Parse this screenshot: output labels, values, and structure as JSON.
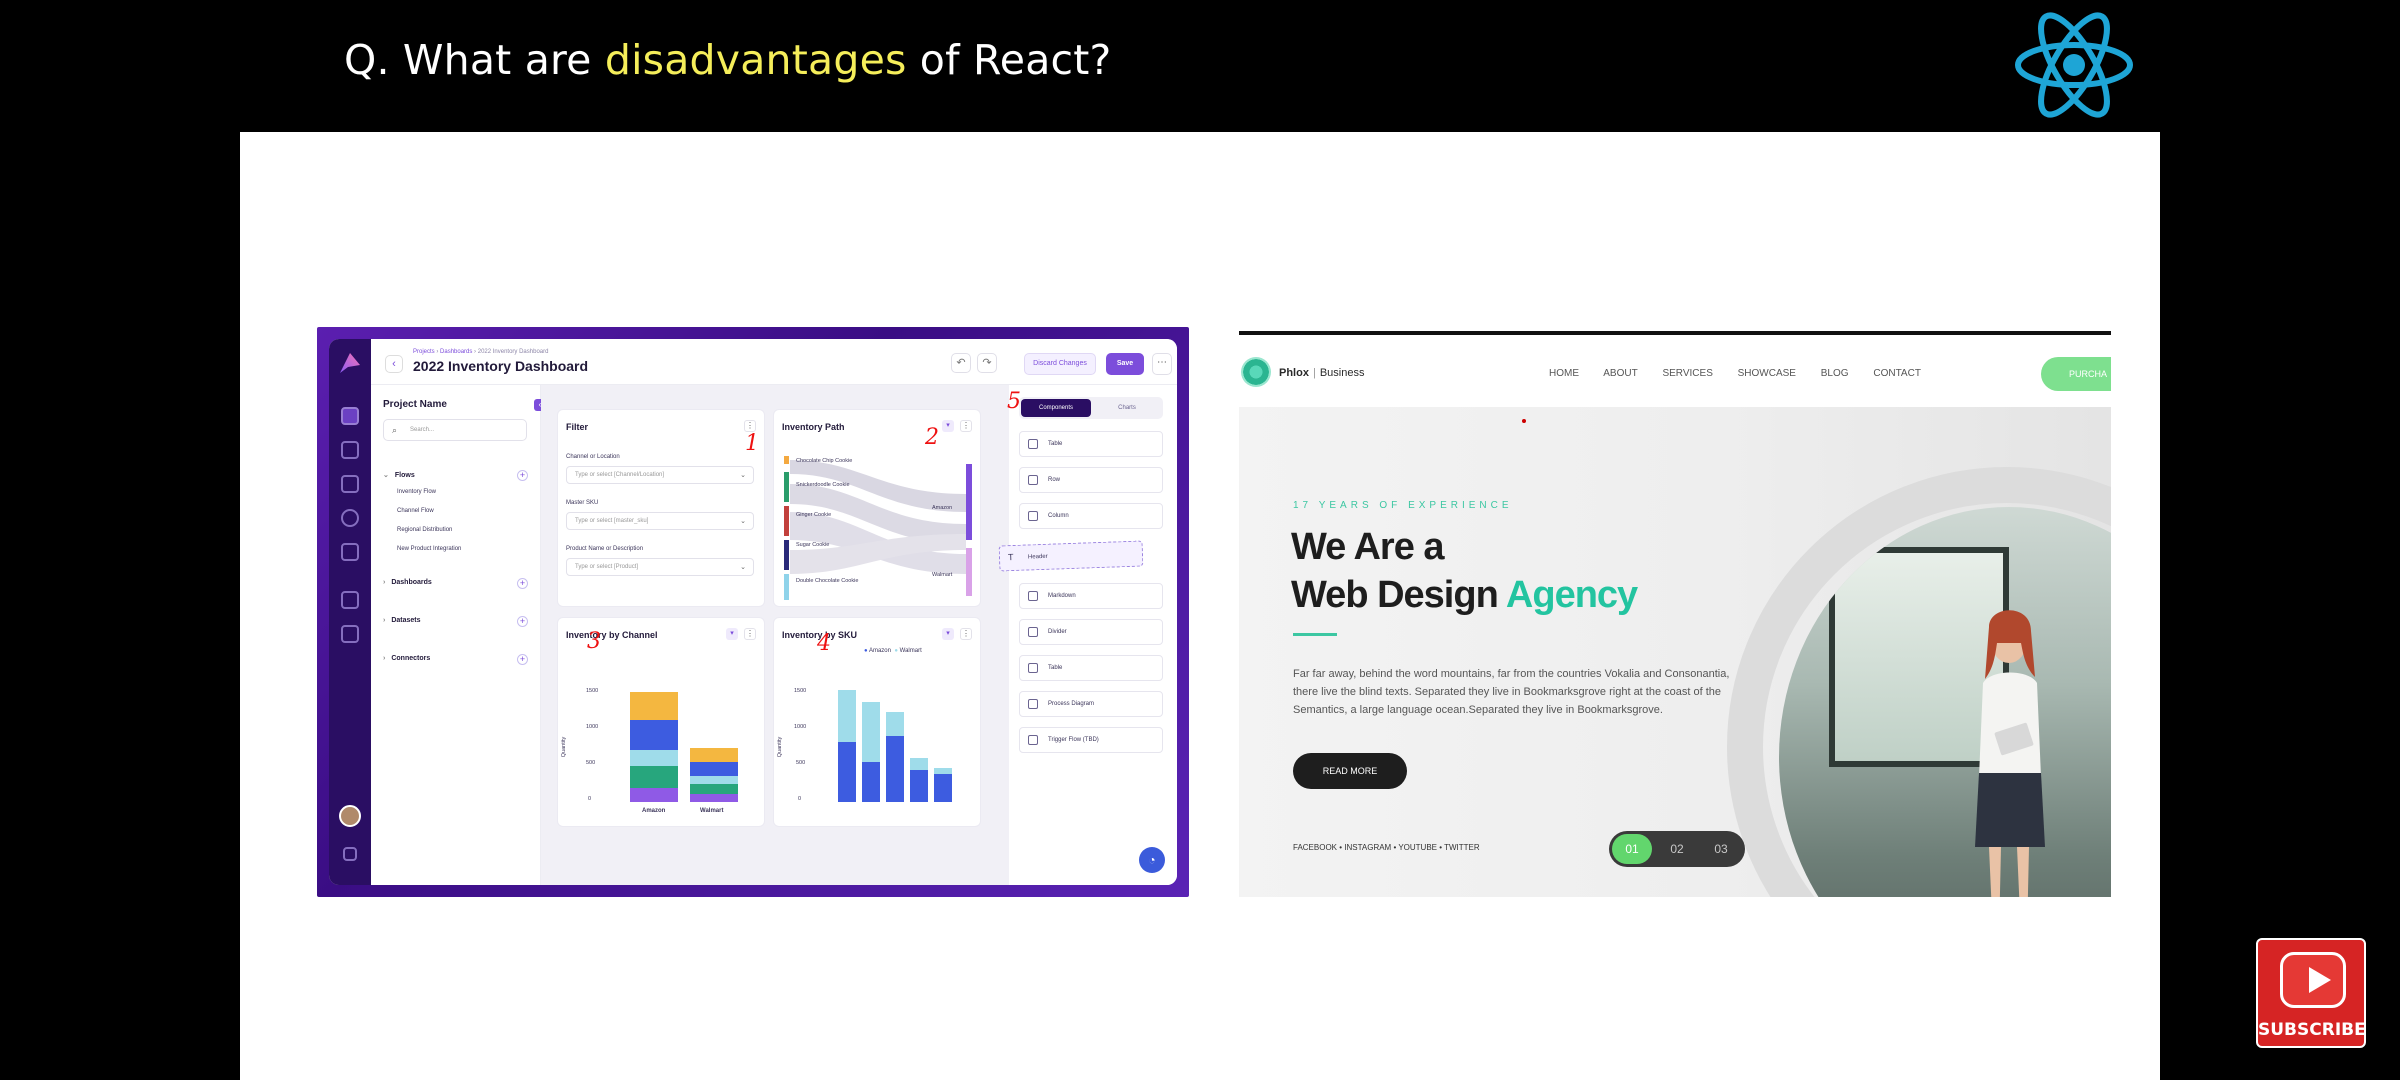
{
  "slide": {
    "title_prefix": "Q. What are ",
    "title_highlight": "disadvantages",
    "title_suffix": " of React?",
    "highlight_color": "#f5ee5a",
    "react_logo_color": "#1ea5d6"
  },
  "dashboard": {
    "breadcrumb": [
      "Projects",
      "Dashboards",
      "2022 Inventory Dashboard"
    ],
    "title": "2022 Inventory Dashboard",
    "discard_label": "Discard Changes",
    "save_label": "Save",
    "more_label": "⋯",
    "side": {
      "title": "Project Name",
      "search_placeholder": "Search...",
      "sections": [
        {
          "label": "Flows",
          "items": [
            "Inventory Flow",
            "Channel Flow",
            "Regional Distribution",
            "New Product Integration"
          ]
        },
        {
          "label": "Dashboards"
        },
        {
          "label": "Datasets"
        },
        {
          "label": "Connectors"
        }
      ]
    },
    "filter": {
      "title": "Filter",
      "fields": [
        {
          "label": "Channel or Location",
          "placeholder": "Type or select [Channel/Location]"
        },
        {
          "label": "Master SKU",
          "placeholder": "Type or select [master_sku]"
        },
        {
          "label": "Product Name or Description",
          "placeholder": "Type or select [Product]"
        }
      ]
    },
    "inventory_path": {
      "title": "Inventory Path",
      "items": [
        "Chocolate Chip Cookie",
        "Snickerdoodle Cookie",
        "Ginger Cookie",
        "Sugar Cookie",
        "Double Chocolate Cookie"
      ],
      "targets": [
        "Amazon",
        "Walmart"
      ]
    },
    "by_channel": {
      "title": "Inventory by Channel",
      "ylabel": "Quantity",
      "ticks": [
        "1500",
        "1000",
        "500",
        "0"
      ],
      "categories": [
        "Amazon",
        "Walmart"
      ]
    },
    "by_sku": {
      "title": "Inventory by SKU",
      "ylabel": "Quantity",
      "ticks": [
        "1500",
        "1000",
        "500",
        "0"
      ],
      "legend": [
        "Amazon",
        "Walmart"
      ]
    },
    "components": {
      "tab_active": "Components",
      "tab_inactive": "Charts",
      "items": [
        "Table",
        "Row",
        "Column",
        "Header",
        "Markdown",
        "Divider",
        "Table",
        "Process Diagram",
        "Trigger Flow (TBD)"
      ]
    },
    "annotations": [
      "1",
      "2",
      "3",
      "4",
      "5"
    ]
  },
  "agency": {
    "brand": "Phlox",
    "brand_sub": "Business",
    "nav": [
      "HOME",
      "ABOUT",
      "SERVICES",
      "SHOWCASE",
      "BLOG",
      "CONTACT"
    ],
    "cta": "PURCHA",
    "kicker": "17 YEARS OF EXPERIENCE",
    "headline_line1": "We Are a",
    "headline_line2": "Web Design ",
    "headline_accent": "Agency",
    "paragraph": "Far far away, behind the word mountains, far from the countries Vokalia and Consonantia, there live the blind texts. Separated they live in Bookmarksgrove right at the coast of the Semantics, a large language ocean.Separated they live in Bookmarksgrove.",
    "read_more": "READ MORE",
    "social": "FACEBOOK  •  INSTAGRAM  •  YOUTUBE  •  TWITTER",
    "pager": [
      "01",
      "02",
      "03"
    ],
    "accent_color": "#23c4a0"
  },
  "subscribe": {
    "label": "SUBSCRIBE",
    "color": "#d62424"
  }
}
